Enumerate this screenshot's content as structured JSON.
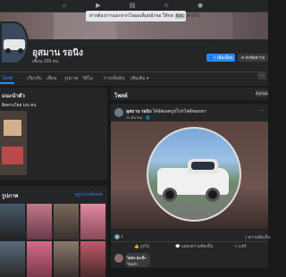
{
  "topbar": {
    "icons": [
      "home-icon",
      "video-icon",
      "marketplace-icon",
      "groups-icon",
      "gaming-icon"
    ]
  },
  "tooltip": {
    "text_before": "หากต้องการออกจากโหมดเต็มหน้าจอ ให้กด",
    "key": "Esc",
    "text_after": "ค้างไว้"
  },
  "profile": {
    "name": "อุสมาน รอนิง",
    "friends": "เพื่อน 109 คน",
    "add_friend_label": "เพิ่มเพื่อน",
    "message_label": "ส่งข้อความ"
  },
  "tabs": [
    {
      "label": "โพสต์"
    },
    {
      "label": "เกี่ยวกับ"
    },
    {
      "label": "เพื่อน"
    },
    {
      "label": "รูปภาพ"
    },
    {
      "label": "วิดีโอ"
    },
    {
      "label": "การเช็คอิน"
    },
    {
      "label": "เพิ่มเติม ▾"
    }
  ],
  "more_button": "···",
  "intro": {
    "title": "แนะนำตัว",
    "line": "ติดตามโดย 101 คน"
  },
  "photos": {
    "title": "รูปภาพ",
    "see_all": "ดูรูปภาพทั้งหมด"
  },
  "posts": {
    "title": "โพสต์",
    "filter": "ตัวกรอง"
  },
  "post": {
    "author": "อุสมาน รอนิง",
    "action": "ได้อัพเดตรูปโปรไฟล์ของเขา",
    "time": "25 มีนาคม · 🌐",
    "dots": "···",
    "reaction_count": "2",
    "comment_count": "1 ความคิดเห็น",
    "like_label": "ถูกใจ",
    "comment_label": "แสดงความคิดเห็น",
    "share_label": "แชร์"
  },
  "comment": {
    "name": "ไฮคล ฮะเป๊ะ",
    "text": "ใช่แล้ว"
  },
  "colors": {
    "accent": "#2d88ff",
    "background": "#18191a",
    "card": "#242526"
  }
}
